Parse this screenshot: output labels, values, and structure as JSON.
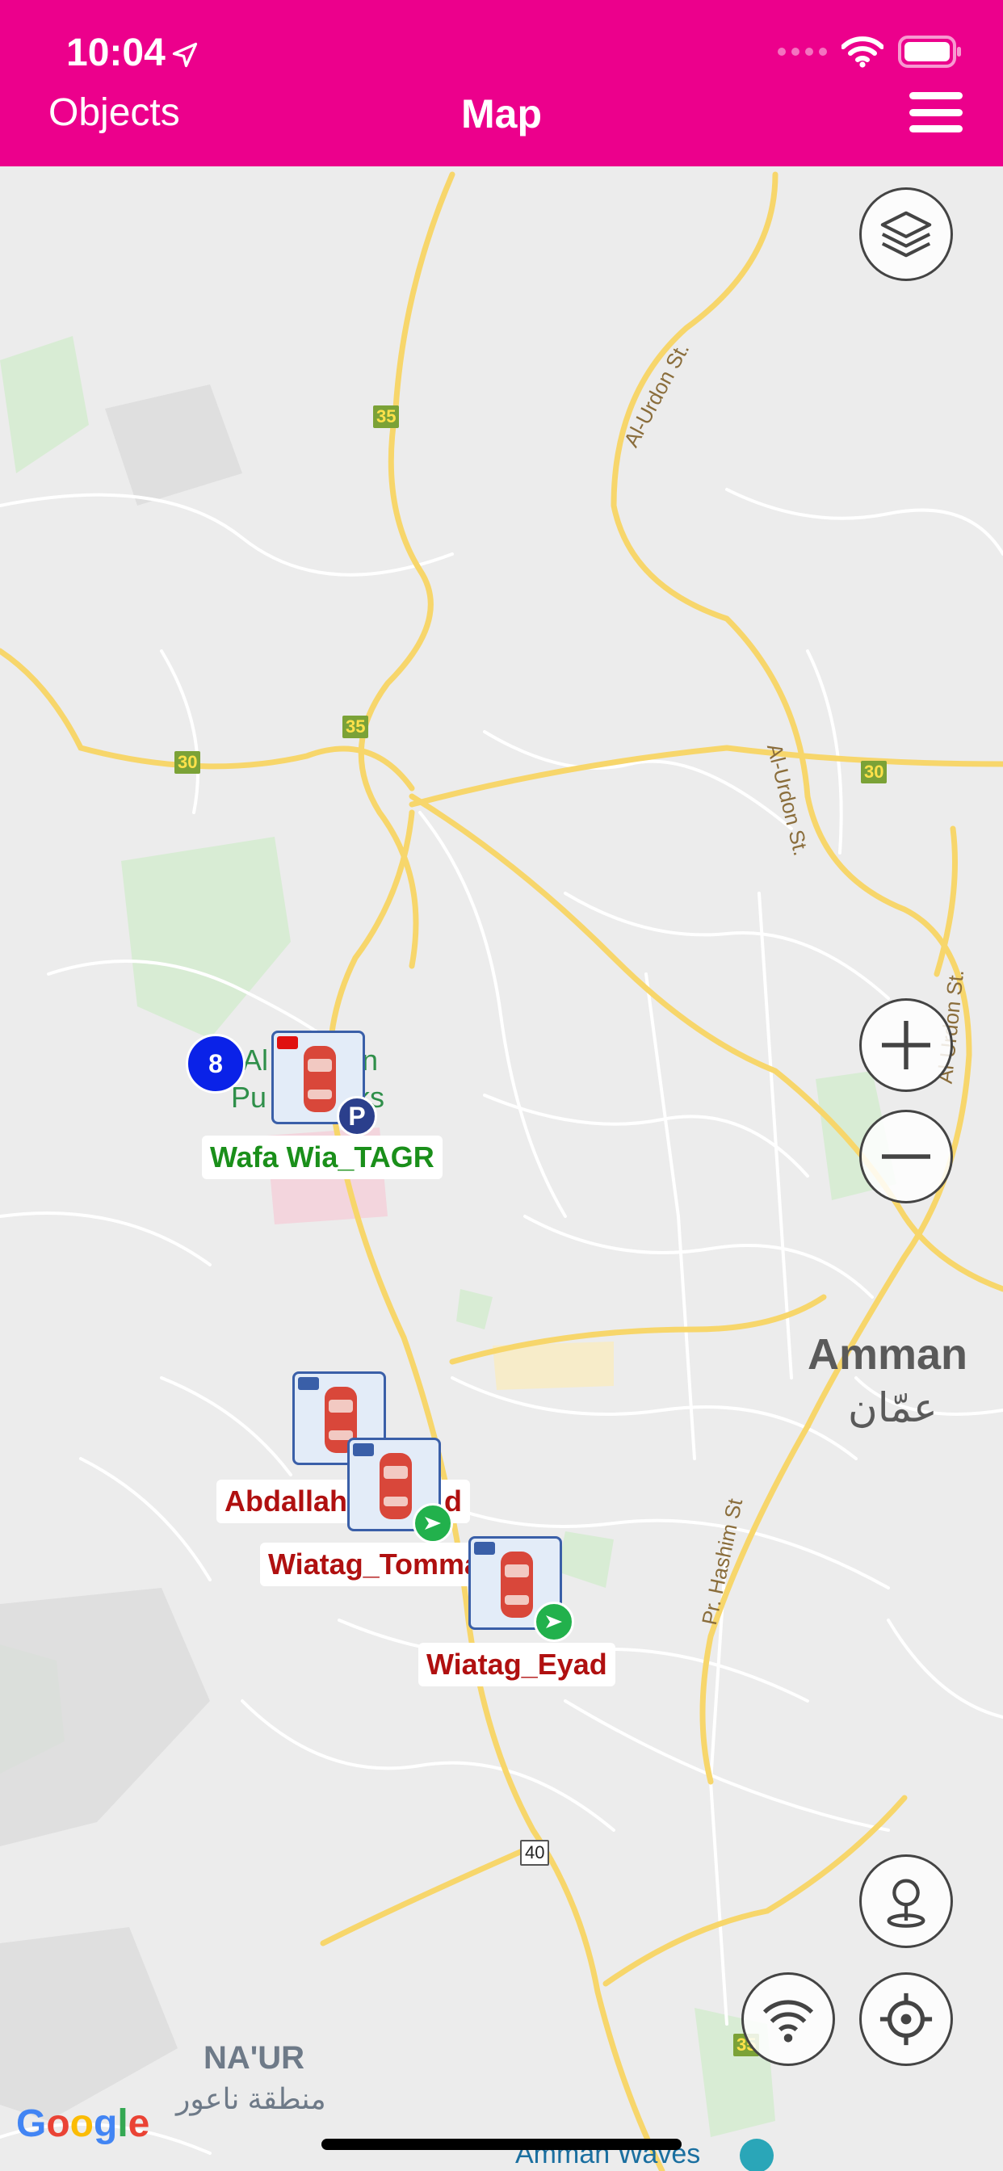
{
  "status_bar": {
    "time": "10:04"
  },
  "nav": {
    "left_label": "Objects",
    "title": "Map"
  },
  "map": {
    "road_numbers": [
      "35",
      "35",
      "30",
      "30",
      "35",
      "40"
    ],
    "streets": [
      "Al-Urdon St.",
      "Al-Urdon St.",
      "Al-Urdon St.",
      "Pr. Hashim St"
    ],
    "places": {
      "park_line1": "Al",
      "park_line1b": "in",
      "park_line2": "Pu",
      "park_line2b": "ks",
      "city_en": "Amman",
      "city_ar": "عمّان",
      "naur_en": "NA'UR",
      "naur_ar": "منطقة ناعور",
      "amman_waves": "Amman Waves"
    },
    "cluster_count": "8",
    "markers": [
      {
        "label": "Wafa Wia_TAGR",
        "label_color": "#1a8f1a",
        "status": "parked",
        "badge": "P"
      },
      {
        "label": "Abdallah",
        "label_suffix": "d",
        "label_color": "#b01010",
        "status": "moving"
      },
      {
        "label": "Wiatag_Tomma",
        "label_color": "#b01010",
        "status": "moving"
      },
      {
        "label": "Wiatag_Eyad",
        "label_color": "#b01010",
        "status": "moving"
      }
    ],
    "attribution": "Google"
  },
  "colors": {
    "accent": "#ec008c",
    "moving_badge": "#22b14c",
    "parked_badge": "#2b3f8c",
    "cluster": "#0a22e8"
  }
}
